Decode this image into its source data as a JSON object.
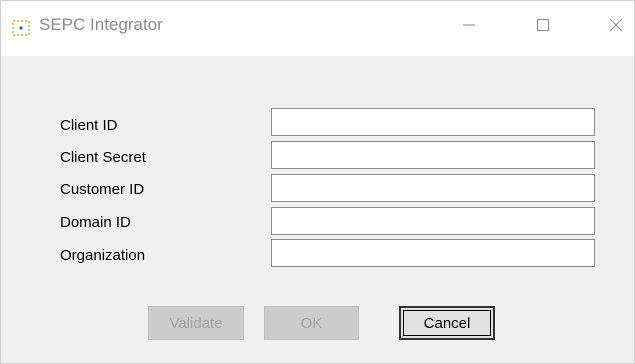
{
  "window": {
    "title": "SEPC Integrator",
    "app_icon": "dotted-frame-icon",
    "controls": {
      "minimize_icon": "minimize-icon",
      "maximize_icon": "maximize-icon",
      "close_icon": "close-icon"
    }
  },
  "form": {
    "fields": [
      {
        "label": "Client ID",
        "value": ""
      },
      {
        "label": "Client Secret",
        "value": ""
      },
      {
        "label": "Customer ID",
        "value": ""
      },
      {
        "label": "Domain ID",
        "value": ""
      },
      {
        "label": "Organization",
        "value": ""
      }
    ]
  },
  "buttons": {
    "validate_label": "Validate",
    "ok_label": "OK",
    "cancel_label": "Cancel"
  },
  "colors": {
    "accent_icon": "#e8a33c",
    "background": "#f0f0f0",
    "titlebar": "#ffffff"
  }
}
